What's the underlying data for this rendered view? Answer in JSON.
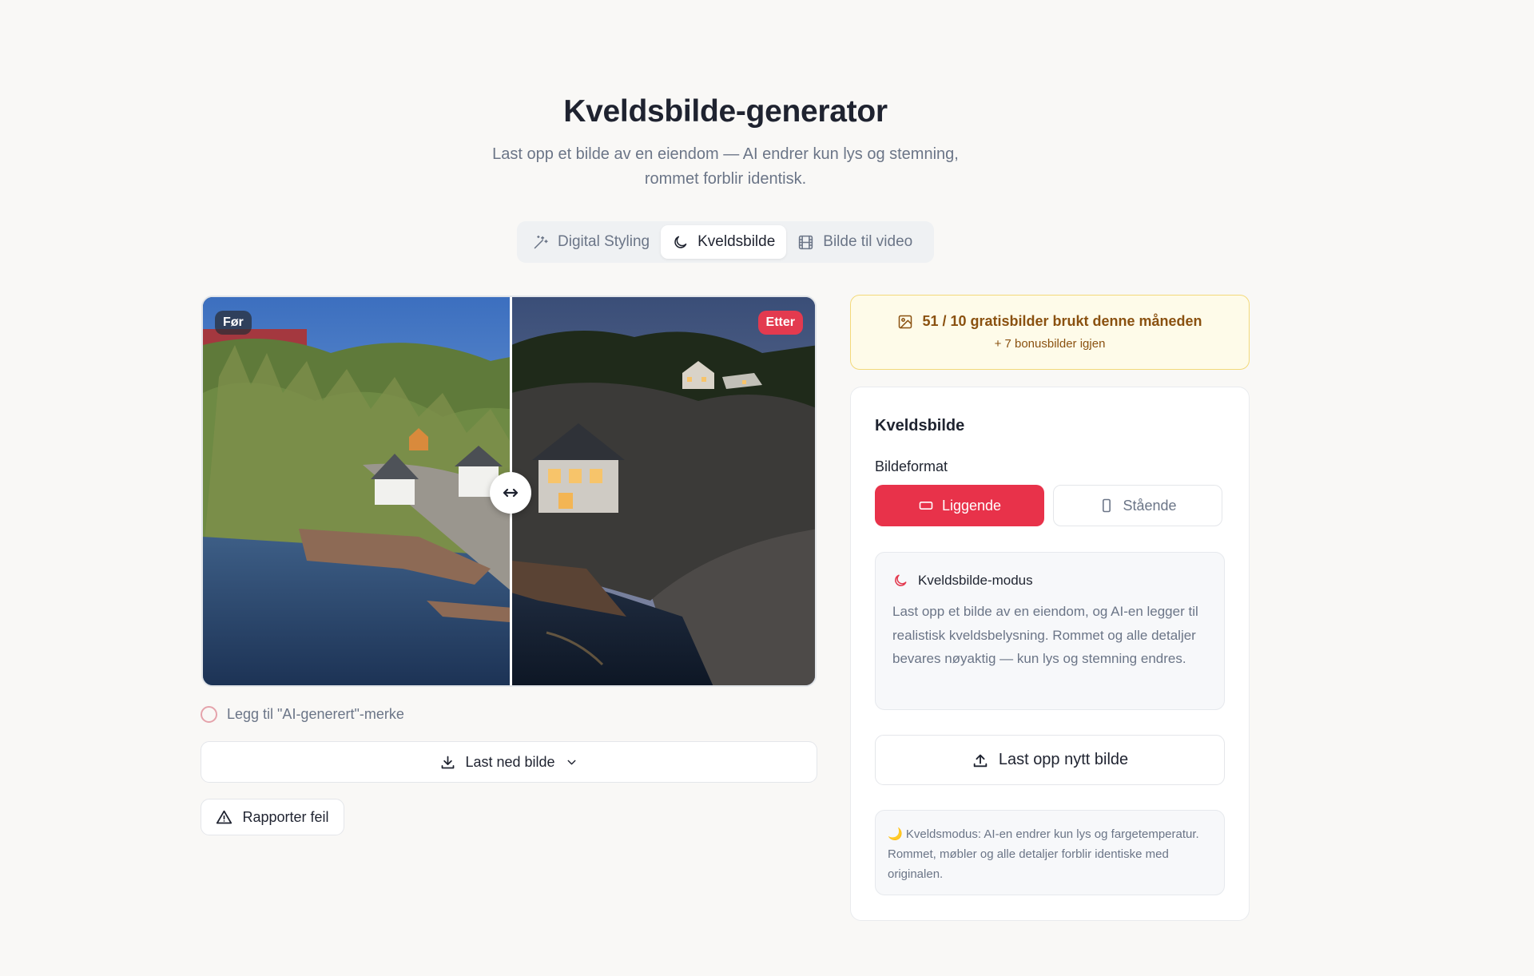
{
  "header": {
    "title": "Kveldsbilde-generator",
    "subtitle_line1": "Last opp et bilde av en eiendom — AI endrer kun lys og stemning,",
    "subtitle_line2": "rommet forblir identisk."
  },
  "tabs": [
    {
      "label": "Digital Styling",
      "icon": "magic-wand-icon",
      "active": false
    },
    {
      "label": "Kveldsbilde",
      "icon": "moon-icon",
      "active": true
    },
    {
      "label": "Bilde til video",
      "icon": "film-icon",
      "active": false
    }
  ],
  "compare": {
    "before_label": "Før",
    "after_label": "Etter",
    "slider_position": 0.5,
    "colors": {
      "after_badge": "#e33a4f"
    }
  },
  "actions": {
    "ai_label_toggle": "Legg til \"AI-generert\"-merke",
    "download": "Last ned bilde",
    "report": "Rapporter feil"
  },
  "quota": {
    "used_text": "51 / 10 gratisbilder brukt denne måneden",
    "bonus_text": "+ 7 bonusbilder igjen"
  },
  "panel": {
    "title": "Kveldsbilde",
    "format_label": "Bildeformat",
    "format_options": [
      {
        "label": "Liggende",
        "icon": "landscape-icon",
        "selected": true
      },
      {
        "label": "Stående",
        "icon": "portrait-icon",
        "selected": false
      }
    ],
    "mode": {
      "title": "Kveldsbilde-modus",
      "description": "Last opp et bilde av en eiendom, og AI-en legger til realistisk kveldsbelysning. Rommet og alle detaljer bevares nøyaktig — kun lys og stemning endres."
    },
    "upload_button": "Last opp nytt bilde",
    "note": "🌙 Kveldsmodus: AI-en endrer kun lys og fargetemperatur. Rommet, møbler og alle detaljer forblir identiske med originalen."
  },
  "colors": {
    "accent": "#e8324a",
    "background": "#f9f8f6",
    "quota_bg": "#fefbe9",
    "quota_text": "#8a5110"
  }
}
